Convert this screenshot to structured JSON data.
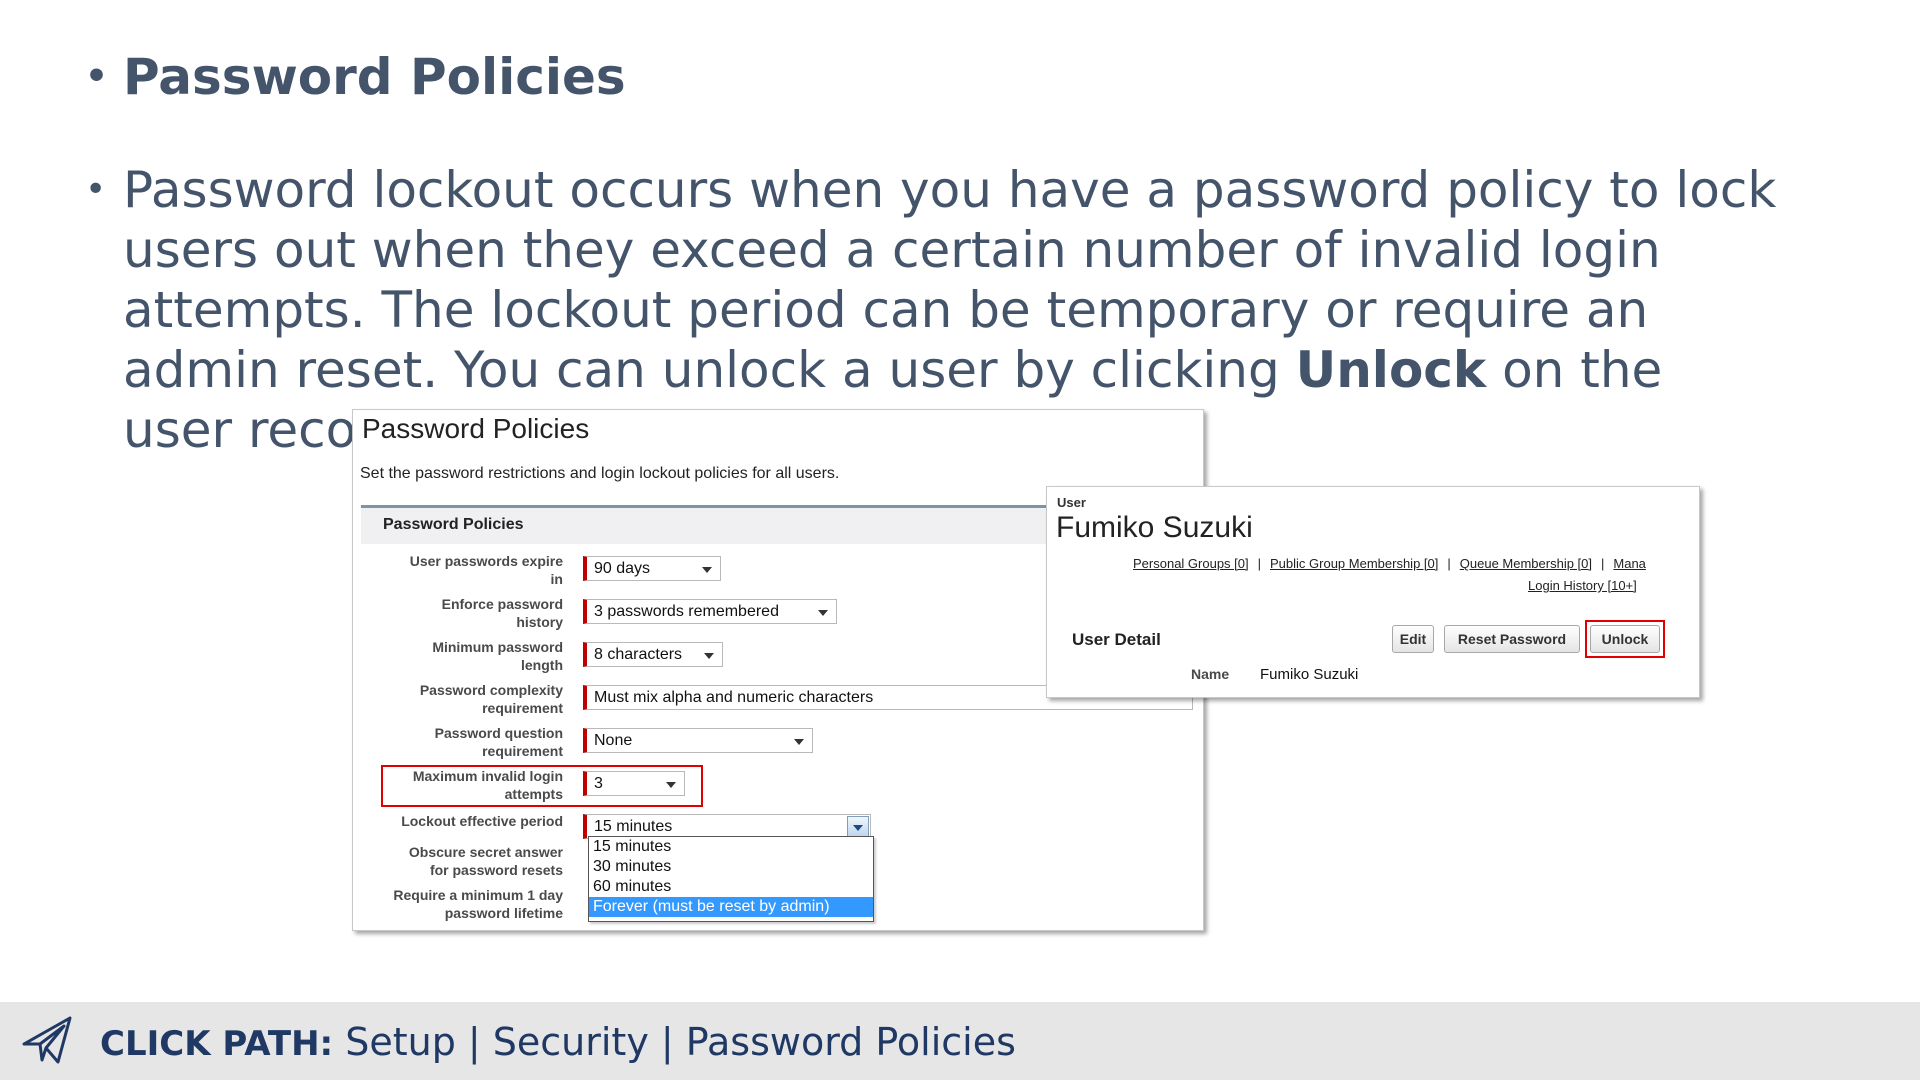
{
  "slide": {
    "bullet_title": "Password Policies",
    "bullet_body_1": "Password lockout occurs when you have a password policy to lock users out when they exceed a certain number of invalid login attempts. The lockout period can be temporary or require an admin reset. You can unlock a user by clicking ",
    "bullet_body_bold": "Unlock",
    "bullet_body_2": " on the user record.",
    "bullet_char": "•"
  },
  "password_policies": {
    "title": "Password Policies",
    "description": "Set the password restrictions and login lockout policies for all users.",
    "section_label": "Password Policies",
    "fields": {
      "expire": {
        "label_1": "User passwords expire",
        "label_2": "in",
        "value": "90 days"
      },
      "history": {
        "label_1": "Enforce password",
        "label_2": "history",
        "value": "3 passwords remembered"
      },
      "min_length": {
        "label_1": "Minimum password",
        "label_2": "length",
        "value": "8 characters"
      },
      "complexity": {
        "label_1": "Password complexity",
        "label_2": "requirement",
        "value": "Must mix alpha and numeric characters"
      },
      "question": {
        "label_1": "Password question",
        "label_2": "requirement",
        "value": "None"
      },
      "max_invalid": {
        "label_1": "Maximum invalid login",
        "label_2": "attempts",
        "value": "3"
      },
      "lockout_period": {
        "label_1": "Lockout effective period",
        "value": "15 minutes"
      },
      "obscure": {
        "label_1": "Obscure secret answer",
        "label_2": "for password resets"
      },
      "min_lifetime": {
        "label_1": "Require a minimum 1 day",
        "label_2": "password lifetime"
      }
    },
    "lockout_options": [
      "15 minutes",
      "30 minutes",
      "60 minutes",
      "Forever (must be reset by admin)"
    ],
    "lockout_highlighted": "Forever (must be reset by admin)"
  },
  "user_record": {
    "caption": "User",
    "name": "Fumiko Suzuki",
    "links": [
      "Personal Groups [0]",
      "Public Group Membership [0]",
      "Queue Membership [0]",
      "Mana"
    ],
    "link_separator": "|",
    "link_second_row": "Login History [10+]",
    "detail_label": "User Detail",
    "buttons": {
      "edit": "Edit",
      "reset_password": "Reset Password",
      "unlock": "Unlock"
    },
    "name_label": "Name",
    "name_value": "Fumiko Suzuki"
  },
  "footer": {
    "icon": "paper-plane-icon",
    "label": "CLICK PATH:",
    "path": " Setup | Security | Password Policies"
  },
  "colors": {
    "slide_text": "#44546a",
    "footer_text": "#1f3864",
    "footer_bg": "#e6e6e6",
    "highlight_red": "#e00000",
    "required_red": "#c00000",
    "dropdown_selected": "#3399ff"
  }
}
